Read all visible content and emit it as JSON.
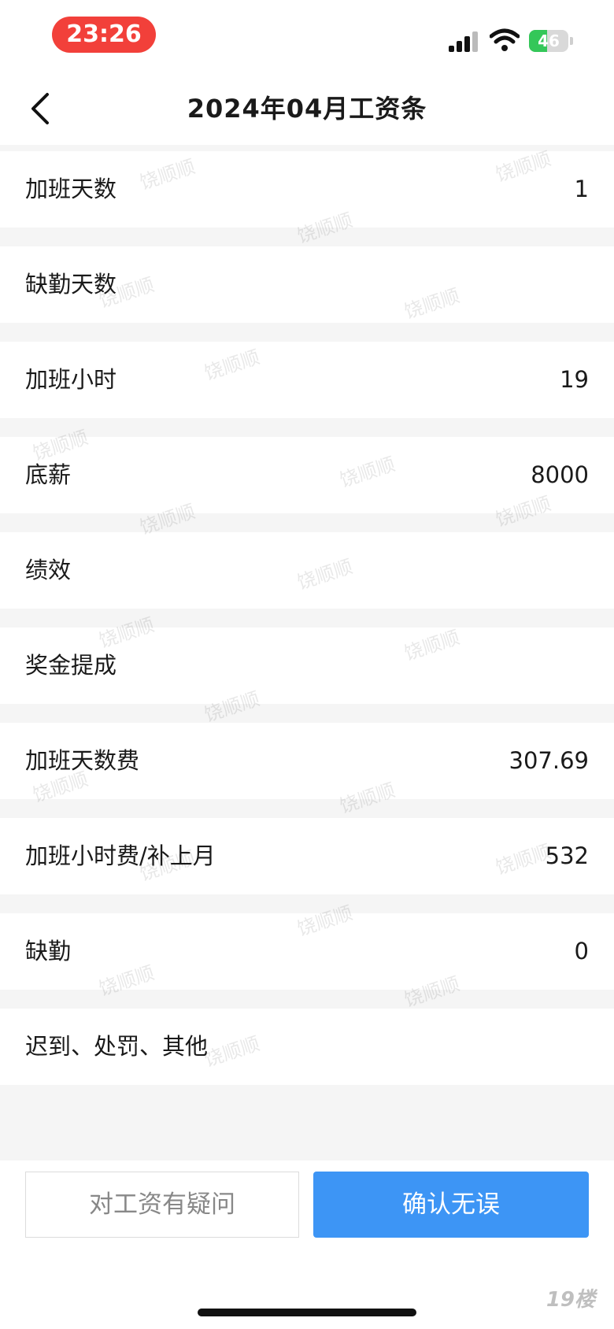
{
  "status_bar": {
    "time": "23:26",
    "battery": "46",
    "battery_level": 0.46
  },
  "header": {
    "title": "2024年04月工资条"
  },
  "rows": [
    {
      "label": "加班天数",
      "value": "1"
    },
    {
      "label": "缺勤天数",
      "value": ""
    },
    {
      "label": "加班小时",
      "value": "19"
    },
    {
      "label": "底薪",
      "value": "8000"
    },
    {
      "label": "绩效",
      "value": ""
    },
    {
      "label": "奖金提成",
      "value": ""
    },
    {
      "label": "加班天数费",
      "value": "307.69"
    },
    {
      "label": "加班小时费/补上月",
      "value": "532"
    },
    {
      "label": "缺勤",
      "value": "0"
    },
    {
      "label": "迟到、处罚、其他",
      "value": ""
    }
  ],
  "watermark_text": "饶顺顺",
  "actions": {
    "question_label": "对工资有疑问",
    "confirm_label": "确认无误"
  },
  "logo_text": "19楼",
  "colors": {
    "time_pill": "#f2403a",
    "confirm": "#3d95f5",
    "battery": "#34c759"
  }
}
